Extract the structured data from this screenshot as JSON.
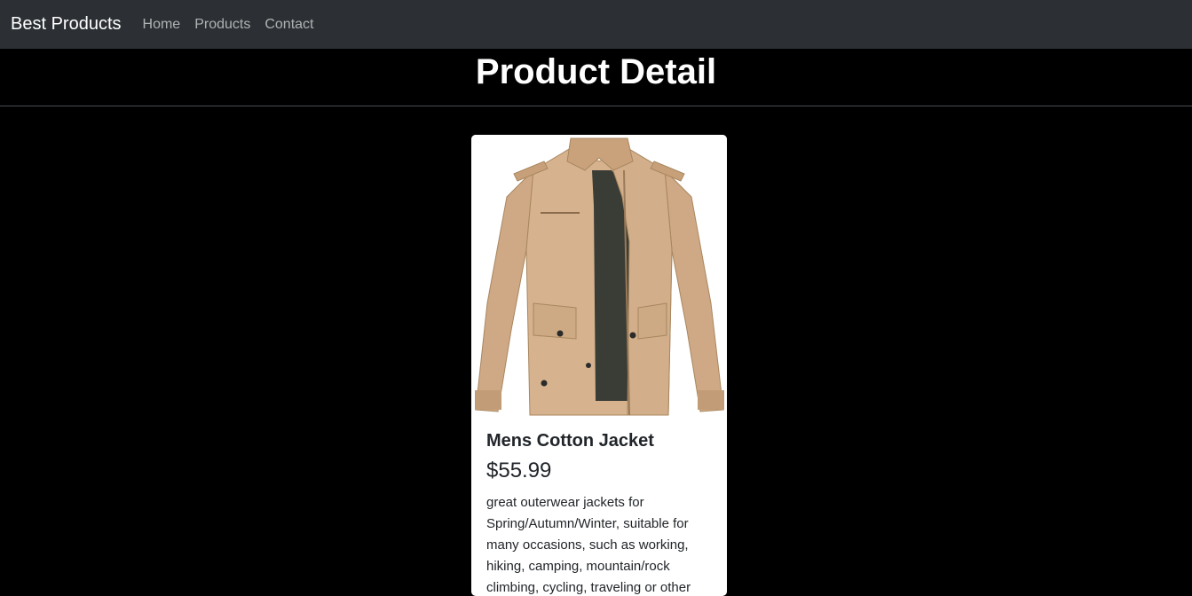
{
  "navbar": {
    "brand": "Best Products",
    "links": [
      {
        "label": "Home"
      },
      {
        "label": "Products"
      },
      {
        "label": "Contact"
      }
    ]
  },
  "page": {
    "title": "Product Detail"
  },
  "product": {
    "image": "jacket-photo",
    "title": "Mens Cotton Jacket",
    "price": "$55.99",
    "description": "great outerwear jackets for Spring/Autumn/Winter, suitable for many occasions, such as working, hiking, camping, mountain/rock climbing, cycling, traveling or other outdoors."
  },
  "colors": {
    "navbar_bg": "#2c3034",
    "page_bg": "#000000",
    "jacket": "#d2b08c"
  }
}
